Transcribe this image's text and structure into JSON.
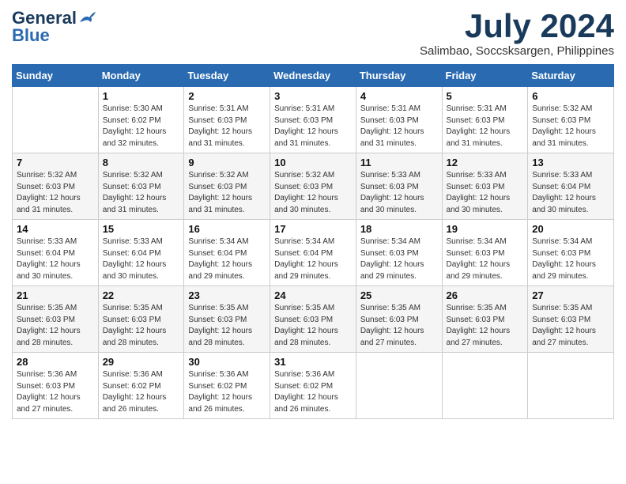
{
  "header": {
    "logo_general": "General",
    "logo_blue": "Blue",
    "month_title": "July 2024",
    "location": "Salimbao, Soccsksargen, Philippines"
  },
  "days_of_week": [
    "Sunday",
    "Monday",
    "Tuesday",
    "Wednesday",
    "Thursday",
    "Friday",
    "Saturday"
  ],
  "weeks": [
    [
      {
        "day": "",
        "info": ""
      },
      {
        "day": "1",
        "info": "Sunrise: 5:30 AM\nSunset: 6:02 PM\nDaylight: 12 hours\nand 32 minutes."
      },
      {
        "day": "2",
        "info": "Sunrise: 5:31 AM\nSunset: 6:03 PM\nDaylight: 12 hours\nand 31 minutes."
      },
      {
        "day": "3",
        "info": "Sunrise: 5:31 AM\nSunset: 6:03 PM\nDaylight: 12 hours\nand 31 minutes."
      },
      {
        "day": "4",
        "info": "Sunrise: 5:31 AM\nSunset: 6:03 PM\nDaylight: 12 hours\nand 31 minutes."
      },
      {
        "day": "5",
        "info": "Sunrise: 5:31 AM\nSunset: 6:03 PM\nDaylight: 12 hours\nand 31 minutes."
      },
      {
        "day": "6",
        "info": "Sunrise: 5:32 AM\nSunset: 6:03 PM\nDaylight: 12 hours\nand 31 minutes."
      }
    ],
    [
      {
        "day": "7",
        "info": "Sunrise: 5:32 AM\nSunset: 6:03 PM\nDaylight: 12 hours\nand 31 minutes."
      },
      {
        "day": "8",
        "info": "Sunrise: 5:32 AM\nSunset: 6:03 PM\nDaylight: 12 hours\nand 31 minutes."
      },
      {
        "day": "9",
        "info": "Sunrise: 5:32 AM\nSunset: 6:03 PM\nDaylight: 12 hours\nand 31 minutes."
      },
      {
        "day": "10",
        "info": "Sunrise: 5:32 AM\nSunset: 6:03 PM\nDaylight: 12 hours\nand 30 minutes."
      },
      {
        "day": "11",
        "info": "Sunrise: 5:33 AM\nSunset: 6:03 PM\nDaylight: 12 hours\nand 30 minutes."
      },
      {
        "day": "12",
        "info": "Sunrise: 5:33 AM\nSunset: 6:03 PM\nDaylight: 12 hours\nand 30 minutes."
      },
      {
        "day": "13",
        "info": "Sunrise: 5:33 AM\nSunset: 6:04 PM\nDaylight: 12 hours\nand 30 minutes."
      }
    ],
    [
      {
        "day": "14",
        "info": "Sunrise: 5:33 AM\nSunset: 6:04 PM\nDaylight: 12 hours\nand 30 minutes."
      },
      {
        "day": "15",
        "info": "Sunrise: 5:33 AM\nSunset: 6:04 PM\nDaylight: 12 hours\nand 30 minutes."
      },
      {
        "day": "16",
        "info": "Sunrise: 5:34 AM\nSunset: 6:04 PM\nDaylight: 12 hours\nand 29 minutes."
      },
      {
        "day": "17",
        "info": "Sunrise: 5:34 AM\nSunset: 6:04 PM\nDaylight: 12 hours\nand 29 minutes."
      },
      {
        "day": "18",
        "info": "Sunrise: 5:34 AM\nSunset: 6:03 PM\nDaylight: 12 hours\nand 29 minutes."
      },
      {
        "day": "19",
        "info": "Sunrise: 5:34 AM\nSunset: 6:03 PM\nDaylight: 12 hours\nand 29 minutes."
      },
      {
        "day": "20",
        "info": "Sunrise: 5:34 AM\nSunset: 6:03 PM\nDaylight: 12 hours\nand 29 minutes."
      }
    ],
    [
      {
        "day": "21",
        "info": "Sunrise: 5:35 AM\nSunset: 6:03 PM\nDaylight: 12 hours\nand 28 minutes."
      },
      {
        "day": "22",
        "info": "Sunrise: 5:35 AM\nSunset: 6:03 PM\nDaylight: 12 hours\nand 28 minutes."
      },
      {
        "day": "23",
        "info": "Sunrise: 5:35 AM\nSunset: 6:03 PM\nDaylight: 12 hours\nand 28 minutes."
      },
      {
        "day": "24",
        "info": "Sunrise: 5:35 AM\nSunset: 6:03 PM\nDaylight: 12 hours\nand 28 minutes."
      },
      {
        "day": "25",
        "info": "Sunrise: 5:35 AM\nSunset: 6:03 PM\nDaylight: 12 hours\nand 27 minutes."
      },
      {
        "day": "26",
        "info": "Sunrise: 5:35 AM\nSunset: 6:03 PM\nDaylight: 12 hours\nand 27 minutes."
      },
      {
        "day": "27",
        "info": "Sunrise: 5:35 AM\nSunset: 6:03 PM\nDaylight: 12 hours\nand 27 minutes."
      }
    ],
    [
      {
        "day": "28",
        "info": "Sunrise: 5:36 AM\nSunset: 6:03 PM\nDaylight: 12 hours\nand 27 minutes."
      },
      {
        "day": "29",
        "info": "Sunrise: 5:36 AM\nSunset: 6:02 PM\nDaylight: 12 hours\nand 26 minutes."
      },
      {
        "day": "30",
        "info": "Sunrise: 5:36 AM\nSunset: 6:02 PM\nDaylight: 12 hours\nand 26 minutes."
      },
      {
        "day": "31",
        "info": "Sunrise: 5:36 AM\nSunset: 6:02 PM\nDaylight: 12 hours\nand 26 minutes."
      },
      {
        "day": "",
        "info": ""
      },
      {
        "day": "",
        "info": ""
      },
      {
        "day": "",
        "info": ""
      }
    ]
  ]
}
